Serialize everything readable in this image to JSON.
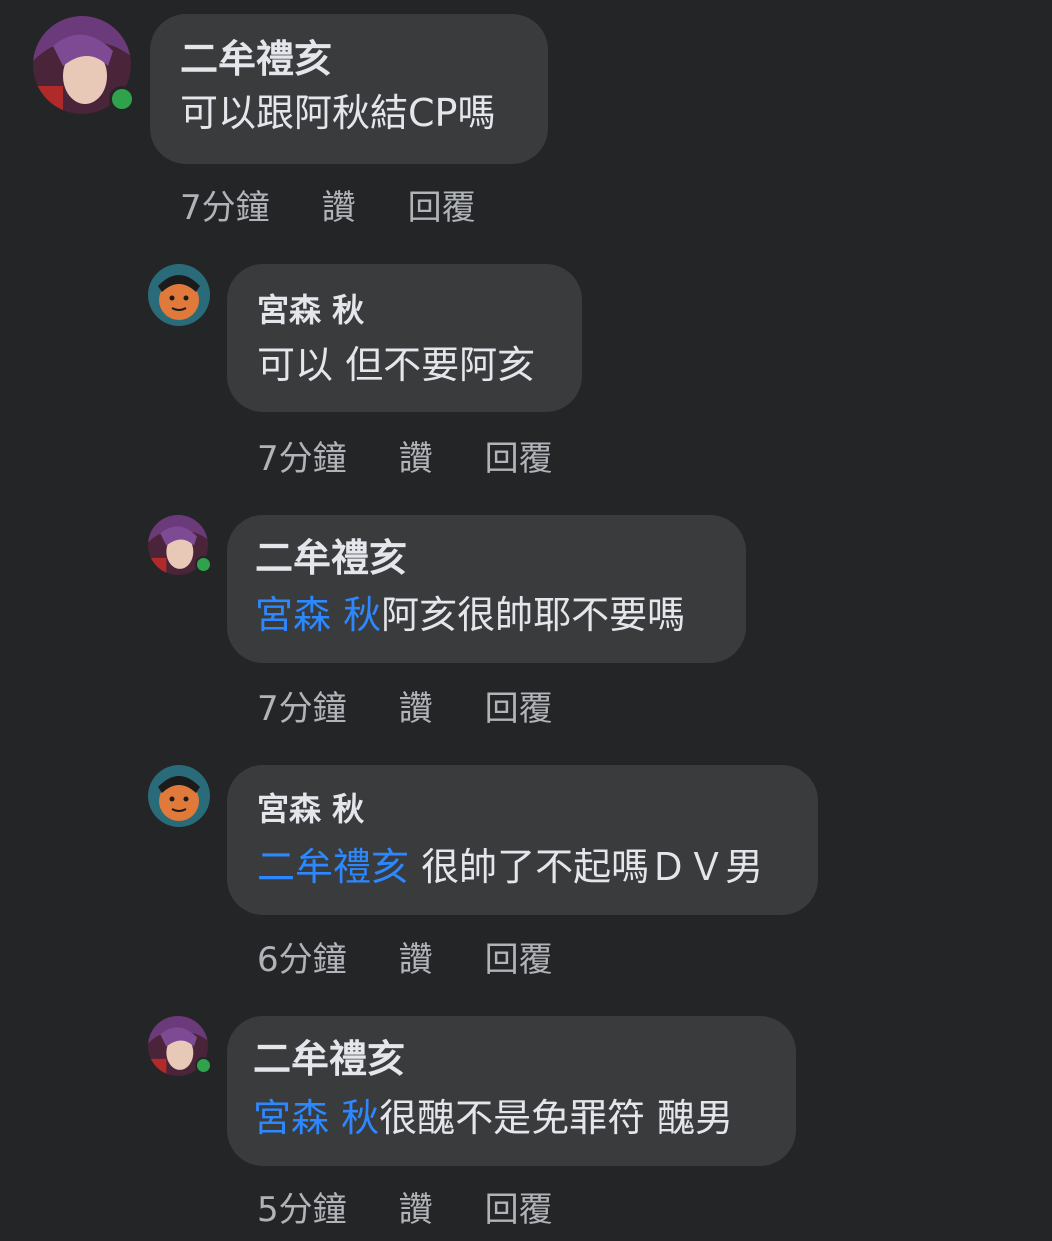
{
  "comments": [
    {
      "author": "二牟禮亥",
      "mention": "",
      "text": "可以跟阿秋結CP嗎",
      "time": "7分鐘",
      "like": "讚",
      "reply": "回覆",
      "avatar": "purple-hair-avatar",
      "online": true
    },
    {
      "author": "宮森 秋",
      "mention": "",
      "text": "可以 但不要阿亥",
      "time": "7分鐘",
      "like": "讚",
      "reply": "回覆",
      "avatar": "orange-face-avatar",
      "online": false
    },
    {
      "author": "二牟禮亥",
      "mention": "宮森 秋",
      "text": "阿亥很帥耶不要嗎",
      "time": "7分鐘",
      "like": "讚",
      "reply": "回覆",
      "avatar": "purple-hair-avatar",
      "online": true
    },
    {
      "author": "宮森 秋",
      "mention": "二牟禮亥",
      "text": " 很帥了不起嗎ＤＶ男",
      "time": "6分鐘",
      "like": "讚",
      "reply": "回覆",
      "avatar": "orange-face-avatar",
      "online": false
    },
    {
      "author": "二牟禮亥",
      "mention": "宮森 秋",
      "text": "很醜不是免罪符 醜男",
      "time": "5分鐘",
      "like": "讚",
      "reply": "回覆",
      "avatar": "purple-hair-avatar",
      "online": true
    }
  ],
  "colors": {
    "background": "#242526",
    "bubble": "#3a3b3c",
    "text": "#e4e6eb",
    "meta": "#b0b3b8",
    "mention": "#2d88ff",
    "online": "#31a24c"
  }
}
